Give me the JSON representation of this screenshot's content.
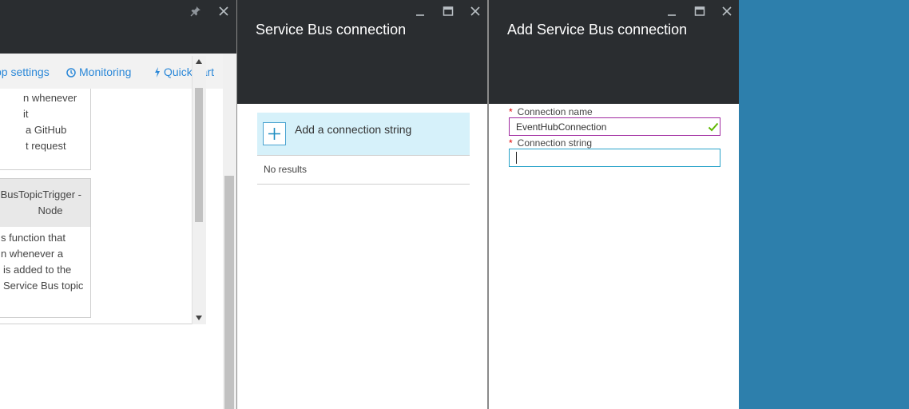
{
  "blade1": {
    "toolbar": {
      "app_settings": "pp settings",
      "monitoring": "Monitoring",
      "quickstart": "Quickstart"
    },
    "card1": {
      "lines": [
        "n whenever it",
        "a GitHub",
        "t request"
      ]
    },
    "card2": {
      "title_line1": "BusTopicTrigger -",
      "title_line2": "Node",
      "lines": [
        "s function that",
        "n whenever a",
        "is added to the",
        "Service Bus topic"
      ]
    }
  },
  "blade2": {
    "title": "Service Bus connection",
    "add_label": "Add a connection string",
    "no_results": "No results"
  },
  "blade3": {
    "title": "Add Service Bus connection",
    "fields": {
      "name_label": "Connection name",
      "name_value": "EventHubConnection",
      "string_label": "Connection string",
      "string_value": ""
    }
  },
  "colors": {
    "header_bg": "#2a2d30",
    "accent_blue": "#2d7fac",
    "link_blue": "#2b88d8",
    "add_highlight": "#d6f1fa",
    "valid_border": "#a02aa0",
    "active_border": "#29a3c9",
    "check_green": "#5fb700",
    "required_red": "#e00000"
  },
  "icons": [
    "pin-icon",
    "close-icon",
    "minimize-icon",
    "maximize-icon",
    "clock-icon",
    "lightning-icon",
    "plus-icon",
    "checkmark-icon"
  ]
}
